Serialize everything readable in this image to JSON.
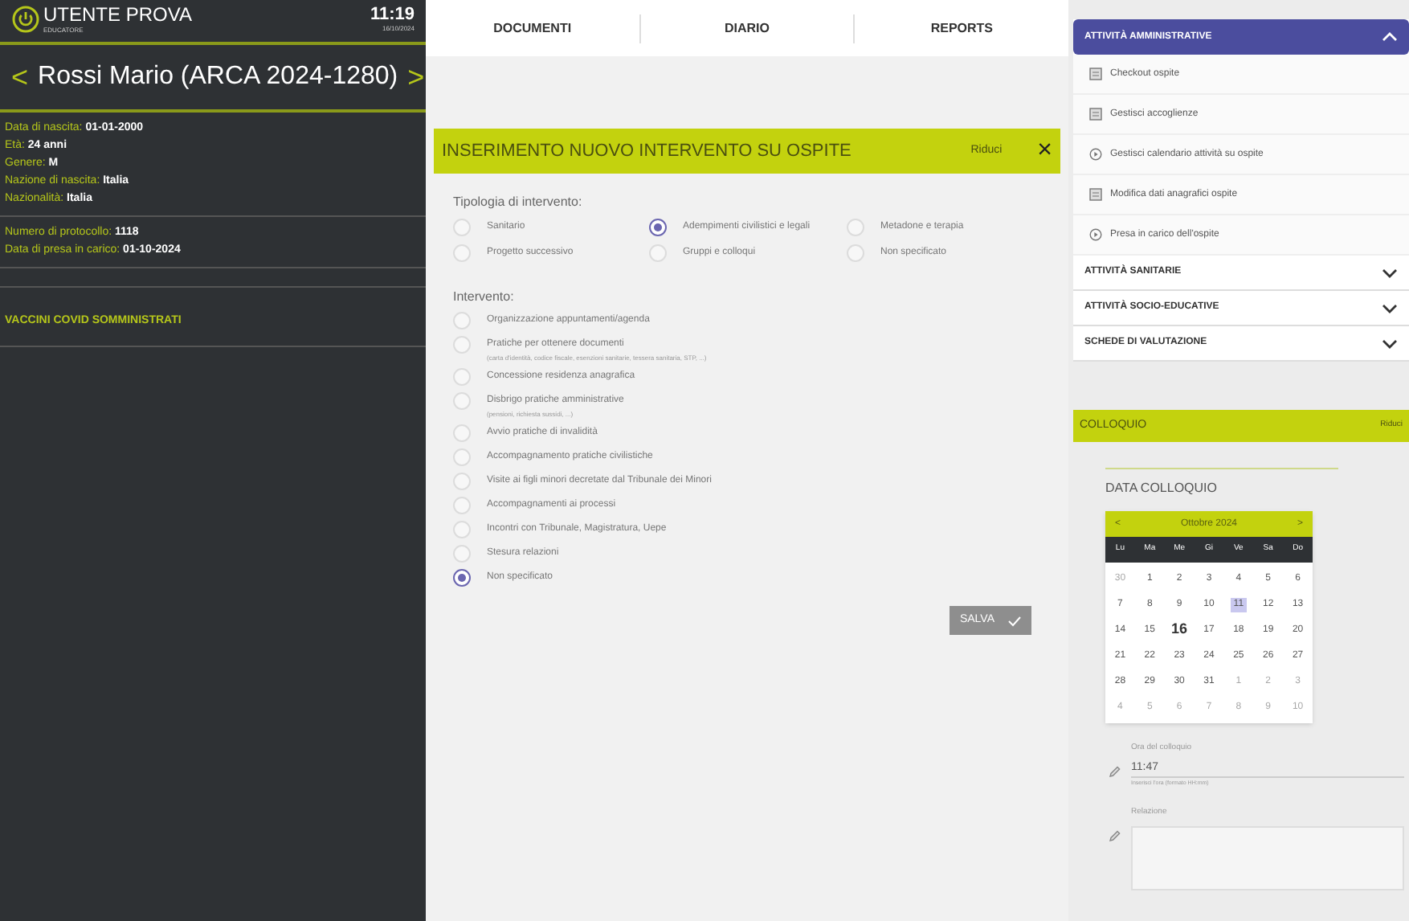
{
  "header": {
    "user": "UTENTE PROVA",
    "role": "EDUCATORE",
    "time": "11:19",
    "date": "16/10/2024"
  },
  "patient": {
    "prev": "<",
    "title": "Rossi Mario (ARCA 2024-1280)",
    "next": ">"
  },
  "info_groups": [
    [
      {
        "label": "Data di nascita:",
        "value": "01-01-2000"
      },
      {
        "label": "Età:",
        "value": "24 anni"
      },
      {
        "label": "Genere:",
        "value": "M"
      },
      {
        "label": "Nazione di nascita:",
        "value": "Italia"
      },
      {
        "label": "Nazionalità:",
        "value": "Italia"
      }
    ],
    [
      {
        "label": "Numero di protocollo:",
        "value": "1118"
      },
      {
        "label": "Data di presa in carico:",
        "value": "01-10-2024"
      }
    ]
  ],
  "vaccini": "VACCINI COVID SOMMINISTRATI",
  "tabs": [
    {
      "label": "DOCUMENTI"
    },
    {
      "label": "DIARIO"
    },
    {
      "label": "REPORTS"
    }
  ],
  "form": {
    "title": "INSERIMENTO NUOVO INTERVENTO SU OSPITE",
    "reduce": "Riduci",
    "close": "×",
    "tipologia": {
      "label": "Tipologia di intervento:",
      "options": [
        {
          "label": "Sanitario",
          "selected": false
        },
        {
          "label": "Adempimenti civilistici e legali",
          "selected": true
        },
        {
          "label": "Metadone e terapia",
          "selected": false
        },
        {
          "label": "Progetto successivo",
          "selected": false
        },
        {
          "label": "Gruppi e colloqui",
          "selected": false
        },
        {
          "label": "Non specificato",
          "selected": false
        }
      ]
    },
    "intervento": {
      "label": "Intervento:",
      "options": [
        {
          "label": "Organizzazione appuntamenti/agenda",
          "selected": false
        },
        {
          "label": "Pratiche per ottenere documenti",
          "note": "(carta d'identità, codice fiscale, esenzioni sanitarie, tessera sanitaria, STP, ...)",
          "selected": false
        },
        {
          "label": "Concessione residenza anagrafica",
          "selected": false
        },
        {
          "label": "Disbrigo pratiche amministrative",
          "note": "(pensioni, richiesta sussidi, ...)",
          "selected": false
        },
        {
          "label": "Avvio pratiche di invalidità",
          "selected": false
        },
        {
          "label": "Accompagnamento pratiche civilistiche",
          "selected": false
        },
        {
          "label": "Visite ai figli minori decretate dal Tribunale dei Minori",
          "selected": false
        },
        {
          "label": "Accompagnamenti ai processi",
          "selected": false
        },
        {
          "label": "Incontri con Tribunale, Magistratura, Uepe",
          "selected": false
        },
        {
          "label": "Stesura relazioni",
          "selected": false
        },
        {
          "label": "Non specificato",
          "selected": true
        }
      ]
    },
    "save": "SALVA"
  },
  "accordion": [
    {
      "title": "ATTIVITÀ AMMINISTRATIVE",
      "expanded": true,
      "items": [
        {
          "label": "Checkout ospite",
          "kind": "form"
        },
        {
          "label": "Gestisci accoglienze",
          "kind": "form"
        },
        {
          "label": "Gestisci calendario attività su ospite",
          "kind": "play"
        },
        {
          "label": "Modifica dati anagrafici ospite",
          "kind": "form"
        },
        {
          "label": "Presa in carico dell'ospite",
          "kind": "play"
        }
      ]
    },
    {
      "title": "ATTIVITÀ SANITARIE",
      "expanded": false
    },
    {
      "title": "ATTIVITÀ SOCIO-EDUCATIVE",
      "expanded": false
    },
    {
      "title": "SCHEDE DI VALUTAZIONE",
      "expanded": false
    }
  ],
  "colloquio": {
    "title": "COLLOQUIO",
    "reduce": "Riduci",
    "date_label": "DATA COLLOQUIO",
    "calendar": {
      "prev": "<",
      "month": "Ottobre 2024",
      "next": ">",
      "weekdays": [
        "Lu",
        "Ma",
        "Me",
        "Gi",
        "Ve",
        "Sa",
        "Do"
      ],
      "weeks": [
        [
          {
            "d": "30",
            "outside": true,
            "selected": false,
            "today": false
          },
          {
            "d": "1",
            "outside": false,
            "selected": false,
            "today": false
          },
          {
            "d": "2",
            "outside": false,
            "selected": false,
            "today": false
          },
          {
            "d": "3",
            "outside": false,
            "selected": false,
            "today": false
          },
          {
            "d": "4",
            "outside": false,
            "selected": false,
            "today": false
          },
          {
            "d": "5",
            "outside": false,
            "selected": false,
            "today": false
          },
          {
            "d": "6",
            "outside": false,
            "selected": false,
            "today": false
          }
        ],
        [
          {
            "d": "7",
            "outside": false,
            "selected": false,
            "today": false
          },
          {
            "d": "8",
            "outside": false,
            "selected": false,
            "today": false
          },
          {
            "d": "9",
            "outside": false,
            "selected": false,
            "today": false
          },
          {
            "d": "10",
            "outside": false,
            "selected": false,
            "today": false
          },
          {
            "d": "11",
            "outside": false,
            "selected": true,
            "today": false
          },
          {
            "d": "12",
            "outside": false,
            "selected": false,
            "today": false
          },
          {
            "d": "13",
            "outside": false,
            "selected": false,
            "today": false
          }
        ],
        [
          {
            "d": "14",
            "outside": false,
            "selected": false,
            "today": false
          },
          {
            "d": "15",
            "outside": false,
            "selected": false,
            "today": false
          },
          {
            "d": "16",
            "outside": false,
            "selected": false,
            "today": true
          },
          {
            "d": "17",
            "outside": false,
            "selected": false,
            "today": false
          },
          {
            "d": "18",
            "outside": false,
            "selected": false,
            "today": false
          },
          {
            "d": "19",
            "outside": false,
            "selected": false,
            "today": false
          },
          {
            "d": "20",
            "outside": false,
            "selected": false,
            "today": false
          }
        ],
        [
          {
            "d": "21",
            "outside": false,
            "selected": false,
            "today": false
          },
          {
            "d": "22",
            "outside": false,
            "selected": false,
            "today": false
          },
          {
            "d": "23",
            "outside": false,
            "selected": false,
            "today": false
          },
          {
            "d": "24",
            "outside": false,
            "selected": false,
            "today": false
          },
          {
            "d": "25",
            "outside": false,
            "selected": false,
            "today": false
          },
          {
            "d": "26",
            "outside": false,
            "selected": false,
            "today": false
          },
          {
            "d": "27",
            "outside": false,
            "selected": false,
            "today": false
          }
        ],
        [
          {
            "d": "28",
            "outside": false,
            "selected": false,
            "today": false
          },
          {
            "d": "29",
            "outside": false,
            "selected": false,
            "today": false
          },
          {
            "d": "30",
            "outside": false,
            "selected": false,
            "today": false
          },
          {
            "d": "31",
            "outside": false,
            "selected": false,
            "today": false
          },
          {
            "d": "1",
            "outside": true,
            "selected": false,
            "today": false
          },
          {
            "d": "2",
            "outside": true,
            "selected": false,
            "today": false
          },
          {
            "d": "3",
            "outside": true,
            "selected": false,
            "today": false
          }
        ],
        [
          {
            "d": "4",
            "outside": true,
            "selected": false,
            "today": false
          },
          {
            "d": "5",
            "outside": true,
            "selected": false,
            "today": false
          },
          {
            "d": "6",
            "outside": true,
            "selected": false,
            "today": false
          },
          {
            "d": "7",
            "outside": true,
            "selected": false,
            "today": false
          },
          {
            "d": "8",
            "outside": true,
            "selected": false,
            "today": false
          },
          {
            "d": "9",
            "outside": true,
            "selected": false,
            "today": false
          },
          {
            "d": "10",
            "outside": true,
            "selected": false,
            "today": false
          }
        ]
      ]
    },
    "time": {
      "label": "Ora del colloquio",
      "value": "11:47",
      "hint": "Inserisci l'ora (formato HH:mm)"
    },
    "relazione": {
      "label": "Relazione"
    }
  }
}
